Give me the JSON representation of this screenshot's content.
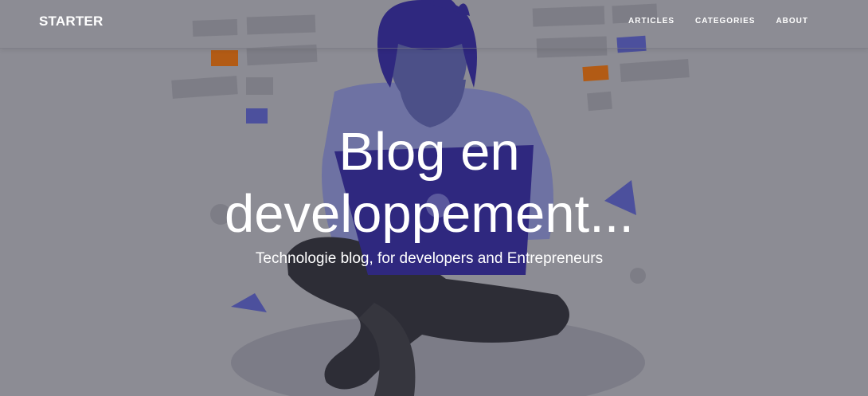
{
  "navbar": {
    "brand": "STARTER",
    "links": [
      {
        "label": "ARTICLES"
      },
      {
        "label": "CATEGORIES"
      },
      {
        "label": "ABOUT"
      }
    ]
  },
  "hero": {
    "title_line1": "Blog en",
    "title_line2": "developpement...",
    "subtitle": "Technologie blog, for developers and Entrepreneurs",
    "illustration": "person-with-laptop-illustration"
  },
  "colors": {
    "overlay": "#8e8e96",
    "accent_purple": "#2c2480",
    "accent_orange": "#c0600a",
    "text": "#ffffff"
  }
}
